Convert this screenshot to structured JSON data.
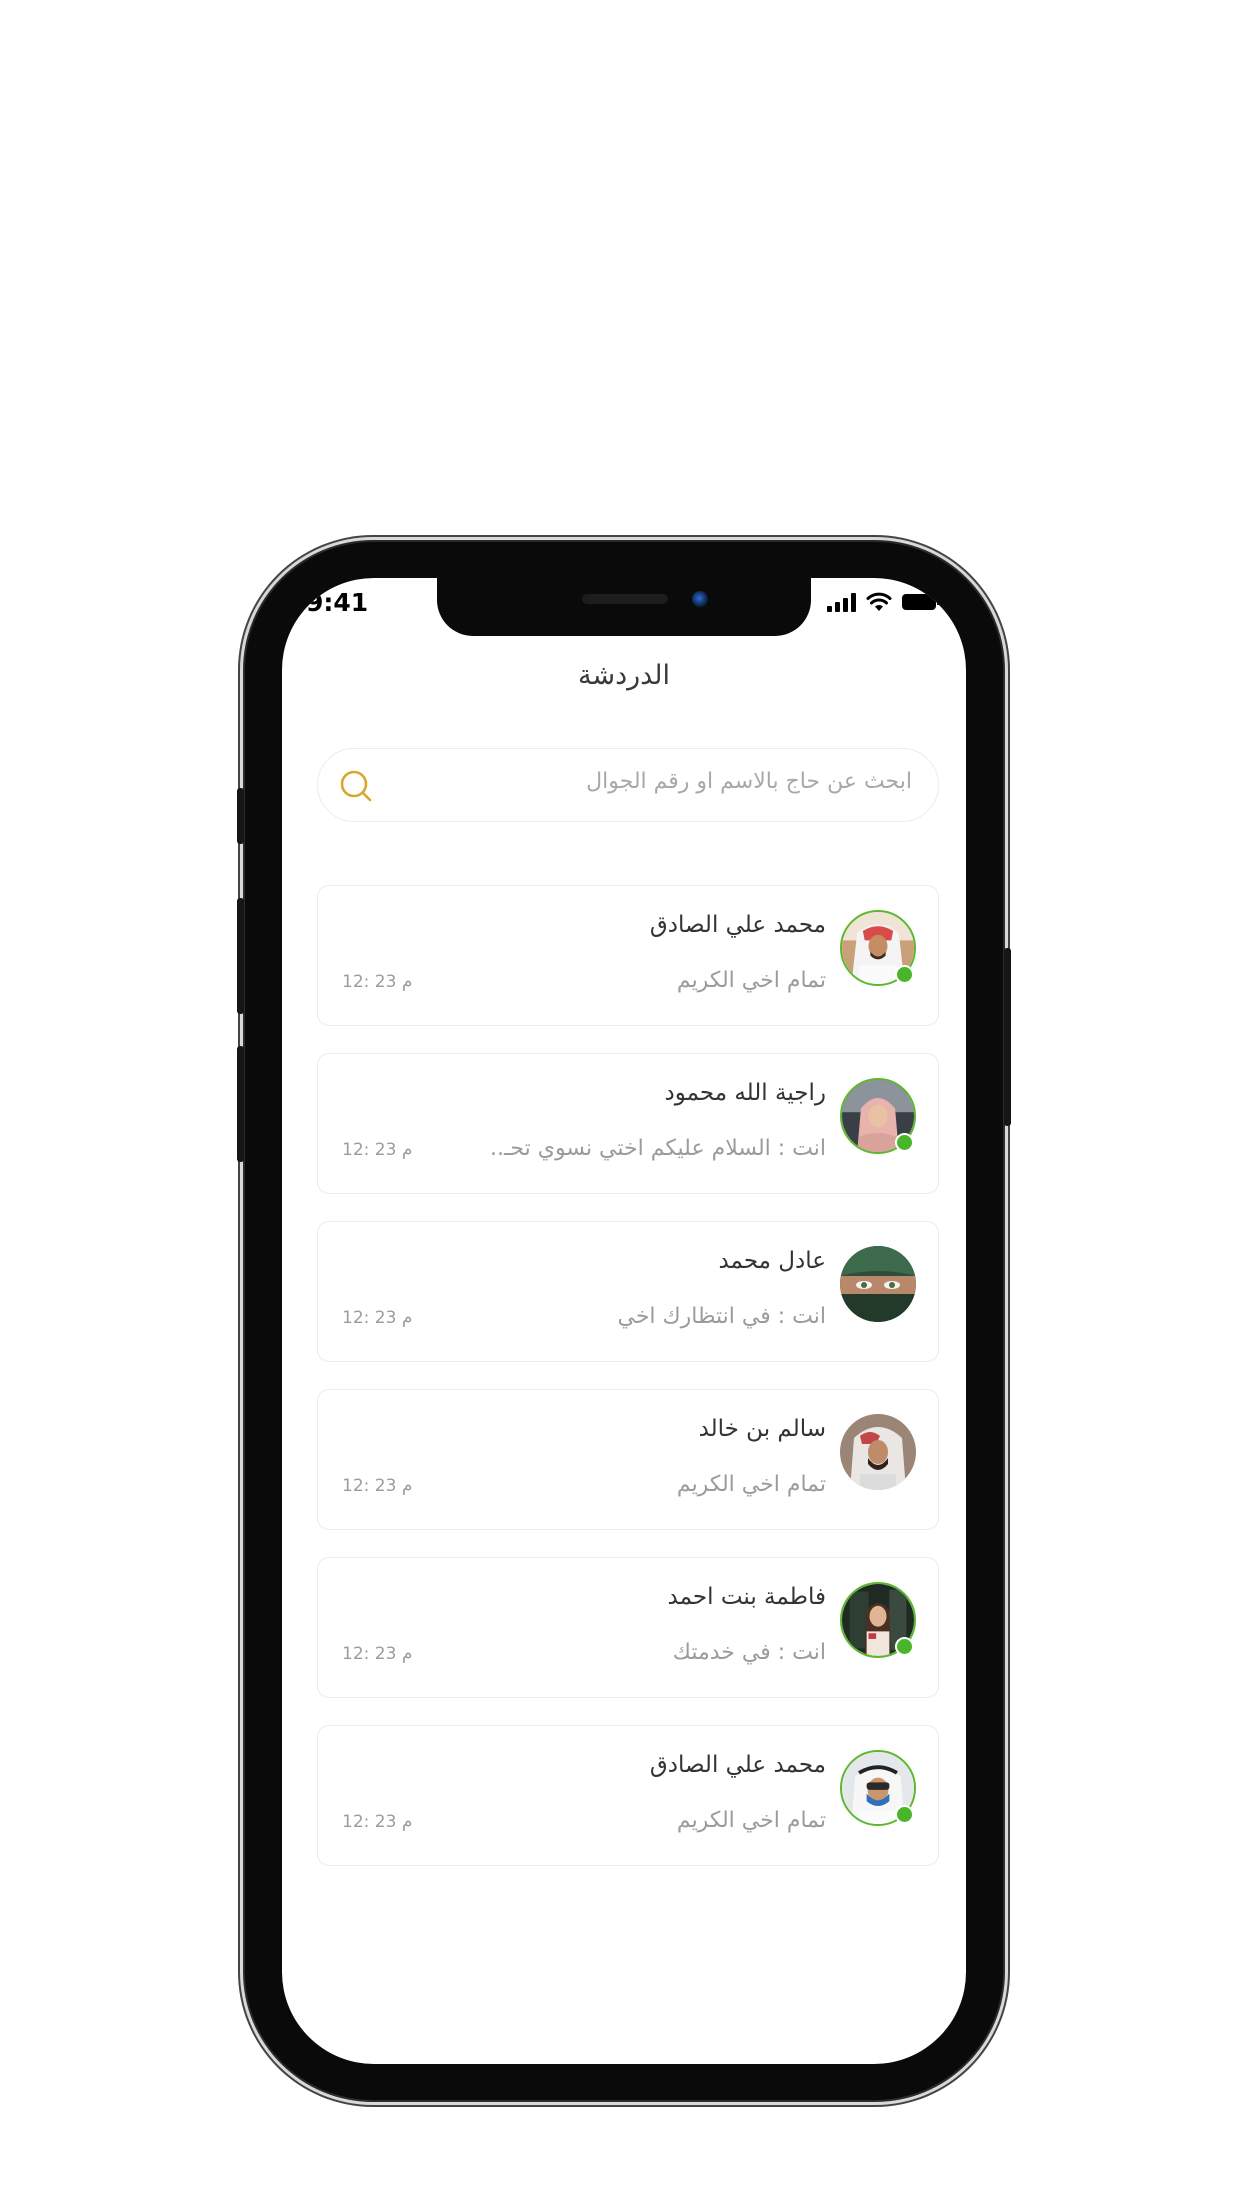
{
  "status_bar": {
    "time": "9:41"
  },
  "header": {
    "title": "الدردشة"
  },
  "search": {
    "placeholder": "ابحث عن حاج بالاسم او رقم الجوال"
  },
  "chats": [
    {
      "name": "محمد علي الصادق",
      "message": "تمام اخي الكريم",
      "time": "12: 23 م",
      "online": true
    },
    {
      "name": "راجية الله محمود",
      "message": "انت : السلام عليكم اختي نسوي تحـ..",
      "time": "12: 23 م",
      "online": true
    },
    {
      "name": "عادل محمد",
      "message": "انت : في انتظارك اخي",
      "time": "12: 23 م",
      "online": false
    },
    {
      "name": "سالم بن خالد",
      "message": "تمام اخي الكريم",
      "time": "12: 23 م",
      "online": false
    },
    {
      "name": "فاطمة بنت احمد",
      "message": "انت : في خدمتك",
      "time": "12: 23 م",
      "online": true
    },
    {
      "name": "محمد علي الصادق",
      "message": "تمام اخي الكريم",
      "time": "12: 23 م",
      "online": true
    }
  ],
  "colors": {
    "accent": "#d6a72a",
    "online": "#49b52b"
  }
}
